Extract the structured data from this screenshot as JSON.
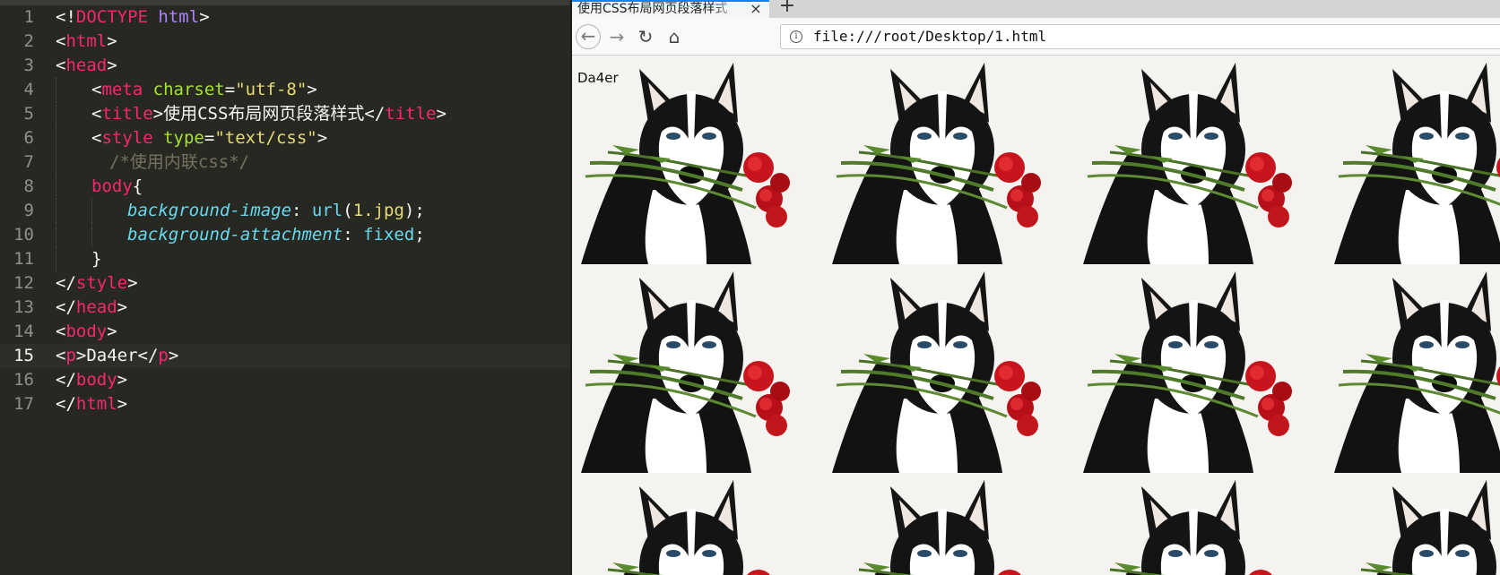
{
  "editor": {
    "lines": [
      {
        "n": "1",
        "indent": 0,
        "tokens": [
          [
            "t-txt",
            "<!"
          ],
          [
            "t-tag",
            "DOCTYPE"
          ],
          [
            "t-txt",
            " "
          ],
          [
            "t-kw",
            "html"
          ],
          [
            "t-txt",
            ">"
          ]
        ]
      },
      {
        "n": "2",
        "indent": 0,
        "tokens": [
          [
            "t-txt",
            "<"
          ],
          [
            "t-tag",
            "html"
          ],
          [
            "t-txt",
            ">"
          ]
        ]
      },
      {
        "n": "3",
        "indent": 0,
        "tokens": [
          [
            "t-txt",
            "<"
          ],
          [
            "t-tag",
            "head"
          ],
          [
            "t-txt",
            ">"
          ]
        ]
      },
      {
        "n": "4",
        "indent": 1,
        "tokens": [
          [
            "t-txt",
            "<"
          ],
          [
            "t-tag",
            "meta"
          ],
          [
            "t-txt",
            " "
          ],
          [
            "t-attr",
            "charset"
          ],
          [
            "t-txt",
            "="
          ],
          [
            "t-str",
            "\"utf-8\""
          ],
          [
            "t-txt",
            ">"
          ]
        ]
      },
      {
        "n": "5",
        "indent": 1,
        "tokens": [
          [
            "t-txt",
            "<"
          ],
          [
            "t-tag",
            "title"
          ],
          [
            "t-txt",
            ">使用CSS布局网页段落样式</"
          ],
          [
            "t-tag",
            "title"
          ],
          [
            "t-txt",
            ">"
          ]
        ]
      },
      {
        "n": "6",
        "indent": 1,
        "tokens": [
          [
            "t-txt",
            "<"
          ],
          [
            "t-tag",
            "style"
          ],
          [
            "t-txt",
            " "
          ],
          [
            "t-attr",
            "type"
          ],
          [
            "t-txt",
            "="
          ],
          [
            "t-str",
            "\"text/css\""
          ],
          [
            "t-txt",
            ">"
          ]
        ]
      },
      {
        "n": "7",
        "indent": 1.5,
        "tokens": [
          [
            "t-cmt",
            "/*使用内联css*/"
          ]
        ]
      },
      {
        "n": "8",
        "indent": 1,
        "tokens": [
          [
            "t-tag",
            "body"
          ],
          [
            "t-txt",
            "{"
          ]
        ]
      },
      {
        "n": "9",
        "indent": 2,
        "tokens": [
          [
            "t-prop",
            "background-image"
          ],
          [
            "t-txt",
            ": "
          ],
          [
            "t-fn",
            "url"
          ],
          [
            "t-txt",
            "("
          ],
          [
            "t-num",
            "1.jpg"
          ],
          [
            "t-txt",
            ");"
          ]
        ]
      },
      {
        "n": "10",
        "indent": 2,
        "tokens": [
          [
            "t-prop",
            "background-attachment"
          ],
          [
            "t-txt",
            ": "
          ],
          [
            "t-fn",
            "fixed"
          ],
          [
            "t-txt",
            ";"
          ]
        ]
      },
      {
        "n": "11",
        "indent": 1,
        "tokens": [
          [
            "t-txt",
            "}"
          ]
        ]
      },
      {
        "n": "12",
        "indent": 0,
        "tokens": [
          [
            "t-txt",
            "</"
          ],
          [
            "t-tag",
            "style"
          ],
          [
            "t-txt",
            ">"
          ]
        ]
      },
      {
        "n": "13",
        "indent": 0,
        "tokens": [
          [
            "t-txt",
            "</"
          ],
          [
            "t-tag",
            "head"
          ],
          [
            "t-txt",
            ">"
          ]
        ]
      },
      {
        "n": "14",
        "indent": 0,
        "tokens": [
          [
            "t-txt",
            "<"
          ],
          [
            "t-tag",
            "body"
          ],
          [
            "t-txt",
            ">"
          ]
        ]
      },
      {
        "n": "15",
        "indent": 0,
        "active": true,
        "tokens": [
          [
            "t-txt",
            "<"
          ],
          [
            "t-tag",
            "p"
          ],
          [
            "t-txt",
            ">Da4er</"
          ],
          [
            "t-tag",
            "p"
          ],
          [
            "t-txt",
            ">"
          ]
        ]
      },
      {
        "n": "16",
        "indent": 0,
        "tokens": [
          [
            "t-txt",
            "</"
          ],
          [
            "t-tag",
            "body"
          ],
          [
            "t-txt",
            ">"
          ]
        ]
      },
      {
        "n": "17",
        "indent": 0,
        "tokens": [
          [
            "t-txt",
            "</"
          ],
          [
            "t-tag",
            "html"
          ],
          [
            "t-txt",
            ">"
          ]
        ]
      }
    ]
  },
  "browser": {
    "tab_title": "使用CSS布局网页段落样式",
    "tab_close": "×",
    "new_tab": "+",
    "nav": {
      "back": "←",
      "forward": "→",
      "reload": "↻",
      "home": "⌂"
    },
    "info_glyph": "i",
    "url": "file:///root/Desktop/1.html",
    "menu": "•••",
    "page_text": "Da4er"
  },
  "colors": {
    "editor_bg": "#272822",
    "tag": "#f92672",
    "attr": "#a6e22e",
    "string": "#e6db74",
    "accent": "#0a84ff"
  },
  "icons": [
    "info-icon",
    "pocket-icon",
    "husky-with-roses-image"
  ]
}
